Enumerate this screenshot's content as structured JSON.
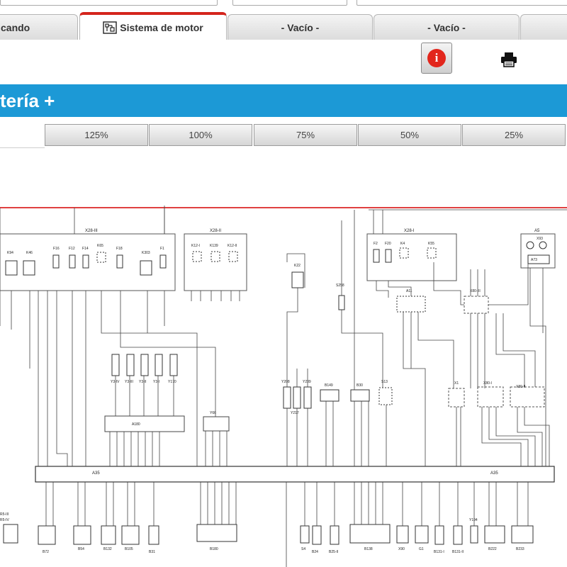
{
  "tabs": [
    {
      "label": "cando"
    },
    {
      "label": "Sistema de motor",
      "icon": "engine-system-icon"
    },
    {
      "label": "- Vacío -"
    },
    {
      "label": "- Vacío -"
    }
  ],
  "toolbar": {
    "info_icon": "info-icon",
    "info_glyph": "i",
    "print_icon": "printer-icon"
  },
  "page_title": "tería +",
  "zoom_levels": [
    "125%",
    "100%",
    "75%",
    "50%",
    "25%"
  ],
  "colors": {
    "accent_title_bar": "#1c99d6",
    "active_tab_border": "#d4241c",
    "info_button": "#e2261c",
    "wire_red": "#e04040"
  },
  "diagram": {
    "connectors": [
      "X28-III",
      "X28-II",
      "X28-I",
      "A5",
      "A35"
    ],
    "labels": {
      "top": [
        "K94",
        "K46",
        "F16",
        "F12",
        "F14",
        "K65",
        "F18",
        "K303",
        "F1",
        "K12-I",
        "K139",
        "K12-II",
        "K22",
        "F2",
        "F20",
        "K4",
        "K55",
        "S258",
        "A11",
        "X93",
        "A73"
      ],
      "mid": [
        "Y3-IV",
        "Y3-III",
        "Y3-II",
        "Y3-I",
        "Y170",
        "A180",
        "Y66",
        "Y208",
        "Y217",
        "Y239",
        "B149",
        "B30",
        "S13",
        "X1",
        "X80-I",
        "X80-II",
        "X80-III"
      ],
      "bottom": [
        "R5-III",
        "R5-IV",
        "B72",
        "B54",
        "B132",
        "B105",
        "B31",
        "B180",
        "S4",
        "B24",
        "B25-II",
        "B138",
        "X90",
        "G1",
        "B131-I",
        "B131-II",
        "Y194",
        "B222",
        "B233"
      ]
    }
  }
}
